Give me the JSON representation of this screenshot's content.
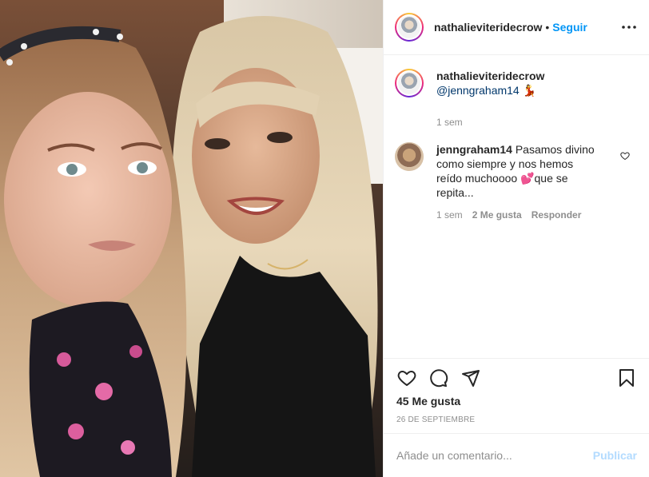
{
  "post": {
    "photo_alt": "two women selfie",
    "author": "nathalieviteridecrow",
    "follow_label": "Seguir",
    "separator": "•",
    "more_icon": "more-horizontal-icon"
  },
  "caption": {
    "username": "nathalieviteridecrow",
    "mention": "@jenngraham14",
    "emoji": "💃",
    "time": "1 sem"
  },
  "comment": {
    "username": "jenngraham14",
    "text_before": "Pasamos divino como siempre y nos hemos reído muchoooo",
    "emoji": "💕",
    "text_after": "que se repita...",
    "time": "1 sem",
    "likes": "2 Me gusta",
    "reply_label": "Responder"
  },
  "actions": {
    "like_icon": "heart-icon",
    "comment_icon": "comment-icon",
    "share_icon": "send-icon",
    "save_icon": "bookmark-icon"
  },
  "likes_text": "45 Me gusta",
  "date_text": "26 DE SEPTIEMBRE",
  "add_comment": {
    "placeholder": "Añade un comentario...",
    "publish_label": "Publicar"
  },
  "colors": {
    "accent": "#0095f6",
    "publish_disabled": "#b3dbff",
    "muted": "#8e8e8e",
    "border": "#efefef"
  }
}
